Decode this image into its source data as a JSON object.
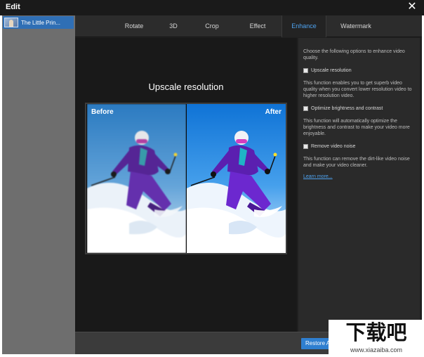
{
  "window": {
    "title": "Edit",
    "close_glyph": "✕"
  },
  "sidebar": {
    "items": [
      {
        "label": "The Little Prin...",
        "icon": "video-thumbnail-icon",
        "selected": true
      }
    ]
  },
  "tabs": [
    {
      "label": "Rotate",
      "active": false
    },
    {
      "label": "3D",
      "active": false
    },
    {
      "label": "Crop",
      "active": false
    },
    {
      "label": "Effect",
      "active": false
    },
    {
      "label": "Enhance",
      "active": true
    },
    {
      "label": "Watermark",
      "active": false
    }
  ],
  "preview": {
    "heading": "Upscale resolution",
    "before_label": "Before",
    "after_label": "After"
  },
  "options": {
    "intro": "Choose the following options to enhance video quality.",
    "items": [
      {
        "label": "Upscale resolution",
        "checked": false,
        "description": "This function enables you to get superb video quality when you convert lower resolution video to higher resolution video."
      },
      {
        "label": "Optimize brightness and contrast",
        "checked": false,
        "description": "This function will automatically optimize the brightness and contrast to make your video more enjoyable."
      },
      {
        "label": "Remove video noise",
        "checked": false,
        "description": "This function can remove the dirt-like video noise and make your video cleaner."
      }
    ],
    "learn_more": "Learn more..."
  },
  "footer": {
    "restore_label": "Restore All"
  },
  "watermark": {
    "text": "下载吧",
    "url": "www.xiazaiba.com"
  },
  "colors": {
    "accent": "#4ea3f0",
    "button_blue": "#2f7fd0",
    "selection_blue": "#2f6fb5",
    "sidebar_gray": "#6e6e6e",
    "panel_dark": "#202020"
  }
}
